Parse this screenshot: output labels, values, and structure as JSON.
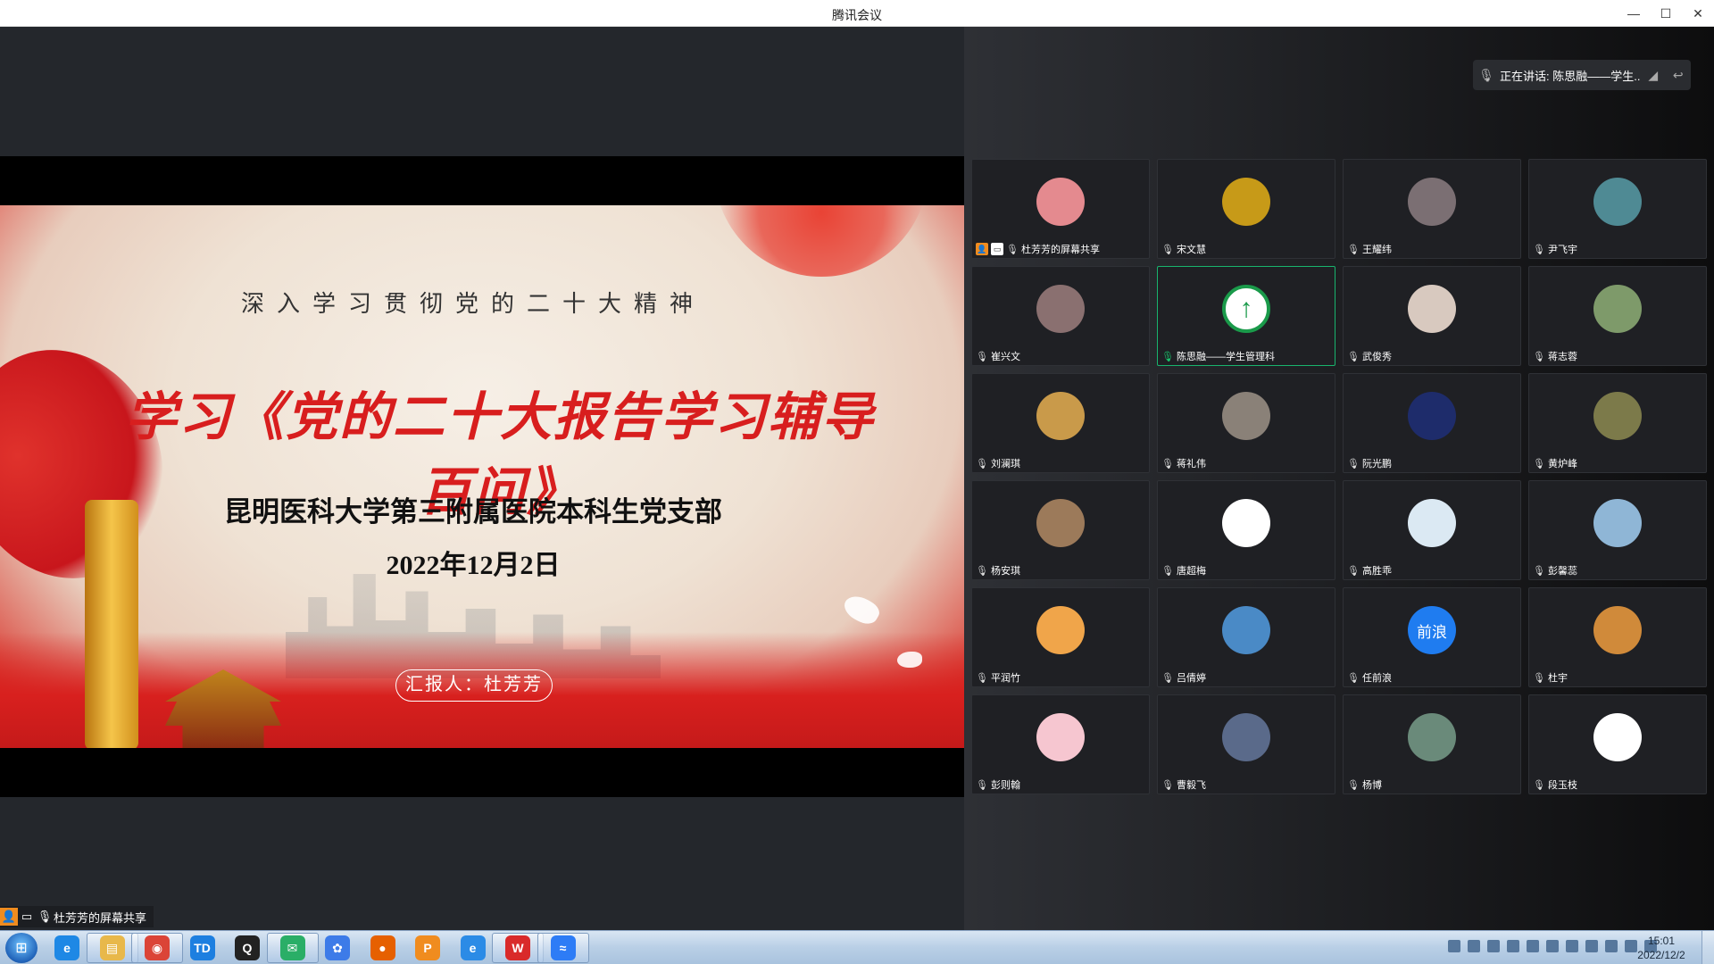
{
  "window": {
    "title": "腾讯会议"
  },
  "share": {
    "slide": {
      "line1": "深入学习贯彻党的二十大精神",
      "line2": "学习《党的二十大报告学习辅导百问》",
      "line3": "昆明医科大学第三附属医院本科生党支部",
      "line4": "2022年12月2日",
      "reporter": "汇报人：杜芳芳"
    },
    "label": "杜芳芳的屏幕共享"
  },
  "speaking": {
    "text": "正在讲话: 陈思融——学生..."
  },
  "participants": [
    {
      "name": "杜芳芳的屏幕共享",
      "color": "#e48a8f",
      "initial": "",
      "host": true
    },
    {
      "name": "宋文慧",
      "color": "#c79a18",
      "initial": ""
    },
    {
      "name": "王耀纬",
      "color": "#7b6f73",
      "initial": ""
    },
    {
      "name": "尹飞宇",
      "color": "#4f8a94",
      "initial": ""
    },
    {
      "name": "崔兴文",
      "color": "#8a7070",
      "initial": ""
    },
    {
      "name": "陈思融——学生管理科",
      "color": "#1a9a4a",
      "initial": "↑",
      "active": true
    },
    {
      "name": "武俊秀",
      "color": "#d8c9bf",
      "initial": ""
    },
    {
      "name": "蒋志蓉",
      "color": "#7e9a6a",
      "initial": ""
    },
    {
      "name": "刘澜琪",
      "color": "#c99a4a",
      "initial": ""
    },
    {
      "name": "蒋礼伟",
      "color": "#8a8178",
      "initial": ""
    },
    {
      "name": "阮光鹏",
      "color": "#1e2c6b",
      "initial": ""
    },
    {
      "name": "黄炉峰",
      "color": "#7c7a4a",
      "initial": ""
    },
    {
      "name": "杨安琪",
      "color": "#9c7a5a",
      "initial": ""
    },
    {
      "name": "唐超梅",
      "color": "#ffffff",
      "initial": ""
    },
    {
      "name": "高胜乖",
      "color": "#dbe9f3",
      "initial": ""
    },
    {
      "name": "彭馨蕊",
      "color": "#8fb6d6",
      "initial": ""
    },
    {
      "name": "平润竹",
      "color": "#f0a54a",
      "initial": ""
    },
    {
      "name": "吕倩婷",
      "color": "#4a8ac6",
      "initial": ""
    },
    {
      "name": "任前浪",
      "color": "#1f7cf0",
      "initial": "前浪"
    },
    {
      "name": "杜宇",
      "color": "#d08a3a",
      "initial": ""
    },
    {
      "name": "彭则翰",
      "color": "#f6c6d0",
      "initial": ""
    },
    {
      "name": "曹毅飞",
      "color": "#5a6a8a",
      "initial": ""
    },
    {
      "name": "杨博",
      "color": "#6a8a7a",
      "initial": ""
    },
    {
      "name": "段玉枝",
      "color": "#ffffff",
      "initial": ""
    }
  ],
  "taskbar": {
    "apps": [
      {
        "name": "ie-icon",
        "color": "#1e88e5",
        "glyph": "e"
      },
      {
        "name": "folder-icon",
        "color": "#e8b84a",
        "glyph": "▤"
      },
      {
        "name": "chrome-icon",
        "color": "#db4437",
        "glyph": "◉"
      },
      {
        "name": "td-icon",
        "color": "#1d7fe0",
        "glyph": "TD"
      },
      {
        "name": "qq-icon",
        "color": "#222222",
        "glyph": "Q"
      },
      {
        "name": "wechat-icon",
        "color": "#2aae67",
        "glyph": "✉"
      },
      {
        "name": "baidu-netdisk-icon",
        "color": "#3d7be8",
        "glyph": "✿"
      },
      {
        "name": "firefox-icon",
        "color": "#e66000",
        "glyph": "●"
      },
      {
        "name": "pdf-icon",
        "color": "#f08c1f",
        "glyph": "P"
      },
      {
        "name": "edge-icon",
        "color": "#2b8be6",
        "glyph": "e"
      },
      {
        "name": "wps-icon",
        "color": "#d92a2a",
        "glyph": "W"
      },
      {
        "name": "tencent-meeting-icon",
        "color": "#2d7cf6",
        "glyph": "≈"
      }
    ],
    "time": "15:01",
    "date": "2022/12/2"
  }
}
